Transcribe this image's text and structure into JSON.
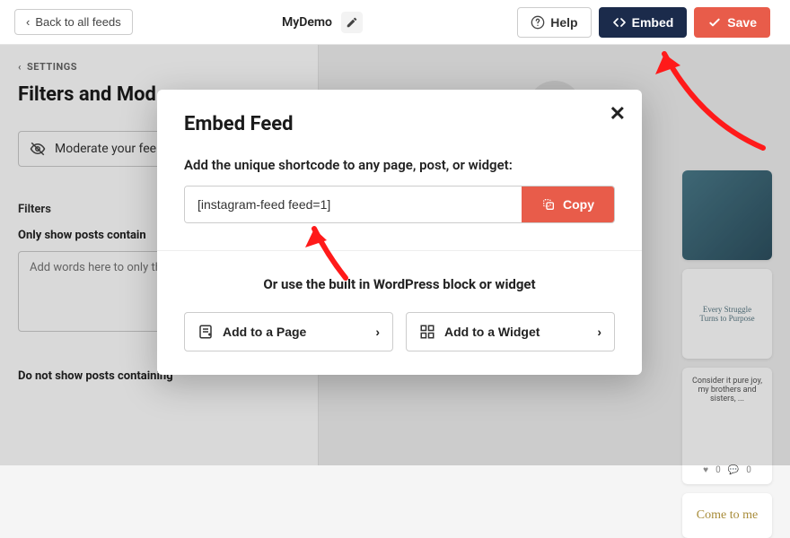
{
  "header": {
    "back_label": "Back to all feeds",
    "title": "MyDemo",
    "help_label": "Help",
    "embed_label": "Embed",
    "save_label": "Save"
  },
  "sidebar": {
    "settings_label": "SETTINGS",
    "heading": "Filters and Mod",
    "moderate_label": "Moderate your fee",
    "filters_label": "Filters",
    "only_show_label": "Only show posts contain",
    "only_show_placeholder": "Add words here to only these words",
    "do_not_show_label": "Do not show posts containing"
  },
  "preview": {
    "tile2_line1": "Every Struggle",
    "tile2_line2": "Turns to Purpose",
    "tile3_text": "Consider it pure joy, my brothers and sisters, ...",
    "tile3_like": "0",
    "tile3_comment": "0",
    "tile4_text": "Come to me"
  },
  "modal": {
    "title": "Embed Feed",
    "subtitle": "Add the unique shortcode to any page, post, or widget:",
    "shortcode": "[instagram-feed feed=1]",
    "copy_label": "Copy",
    "or_text": "Or use the built in WordPress block or widget",
    "add_page_label": "Add to a Page",
    "add_widget_label": "Add to a Widget"
  }
}
